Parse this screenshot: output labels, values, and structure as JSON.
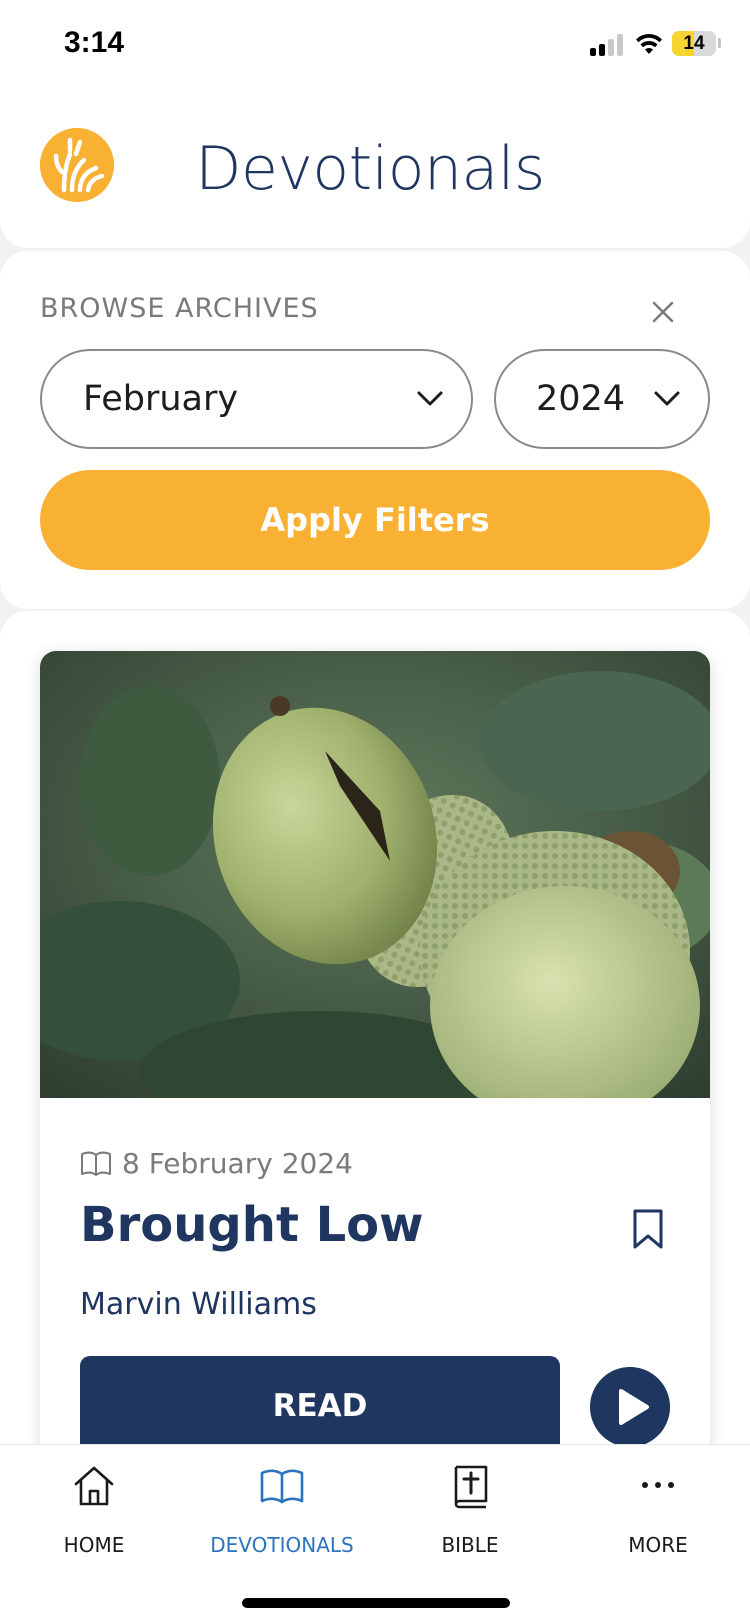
{
  "status_bar": {
    "time": "3:14",
    "battery_level": "14",
    "battery_fraction": 0.14
  },
  "header": {
    "title": "Devotionals",
    "logo_icon": "wheat-logo-icon"
  },
  "filters": {
    "label": "BROWSE ARCHIVES",
    "month": "February",
    "year": "2024",
    "apply_label": "Apply Filters"
  },
  "card": {
    "date": "8 February 2024",
    "title": "Brought Low",
    "author": "Marvin Williams",
    "read_label": "READ",
    "image_alt": "acorns"
  },
  "tabs": [
    {
      "label": "HOME",
      "icon": "home-icon"
    },
    {
      "label": "DEVOTIONALS",
      "icon": "open-book-icon",
      "active": true
    },
    {
      "label": "BIBLE",
      "icon": "bible-icon"
    },
    {
      "label": "MORE",
      "icon": "more-icon"
    }
  ],
  "colors": {
    "accent": "#f8b133",
    "navy": "#1f3660",
    "active_tab": "#2c74bf"
  }
}
